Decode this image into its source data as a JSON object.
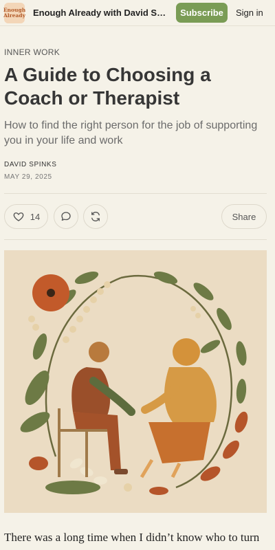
{
  "header": {
    "logo_line1": "Enough",
    "logo_line2": "Already",
    "publication": "Enough Already with David Spinks",
    "subscribe_label": "Subscribe",
    "signin_label": "Sign in"
  },
  "article": {
    "kicker": "INNER WORK",
    "title": "A Guide to Choosing a Coach or Therapist",
    "subtitle": "How to find the right person for the job of supporting you in your life and work",
    "author": "DAVID SPINKS",
    "date": "MAY 29, 2025",
    "body_first_line": "There was a long time when I didn’t know who to turn"
  },
  "actions": {
    "like_count": "14",
    "like_icon": "heart-icon",
    "comment_icon": "comment-icon",
    "restack_icon": "restack-icon",
    "share_label": "Share"
  },
  "colors": {
    "background": "#f5f2e8",
    "subscribe": "#7a9c55",
    "illustration_bg": "#ebdcc3"
  }
}
